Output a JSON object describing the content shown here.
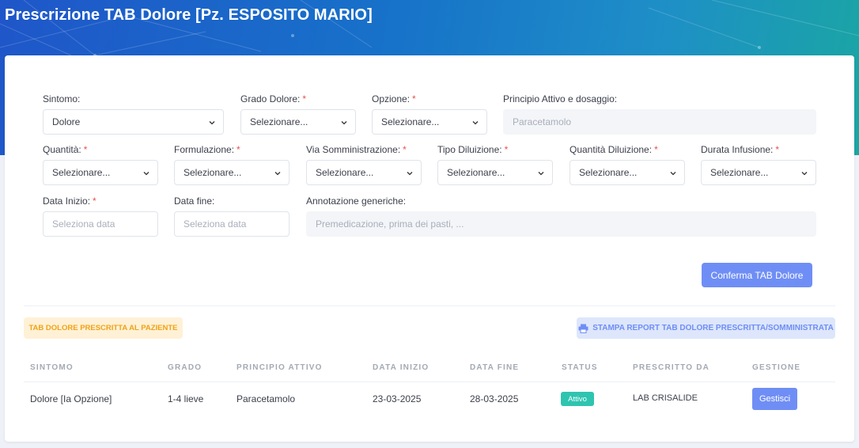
{
  "page": {
    "title": "Prescrizione TAB Dolore [Pz. ESPOSITO MARIO]",
    "colors": {
      "primary": "#6f8ef5",
      "warning": "#f0a215",
      "success": "#2ec4b0",
      "required": "#e5534b"
    }
  },
  "form": {
    "sintomo": {
      "label": "Sintomo:",
      "value": "Dolore"
    },
    "grado": {
      "label": "Grado Dolore:",
      "value": "Selezionare..."
    },
    "opzione": {
      "label": "Opzione:",
      "value": "Selezionare..."
    },
    "principio": {
      "label": "Principio Attivo e dosaggio:",
      "placeholder": "Paracetamolo"
    },
    "quantita": {
      "label": "Quantità:",
      "value": "Selezionare..."
    },
    "formulazione": {
      "label": "Formulazione:",
      "value": "Selezionare..."
    },
    "via": {
      "label": "Via Somministrazione:",
      "value": "Selezionare..."
    },
    "diluizione": {
      "label": "Tipo Diluizione:",
      "value": "Selezionare..."
    },
    "quantita_diluizione": {
      "label": "Quantità Diluizione:",
      "value": "Selezionare..."
    },
    "durata": {
      "label": "Durata Infusione:",
      "value": "Selezionare..."
    },
    "data_inizio": {
      "label": "Data Inizio:",
      "placeholder": "Seleziona data"
    },
    "data_fine": {
      "label": "Data fine:",
      "placeholder": "Seleziona data"
    },
    "annotazione": {
      "label": "Annotazione generiche:",
      "placeholder": "Premedicazione, prima dei pasti, ..."
    },
    "required_mark": "*",
    "confirm_label": "Conferma TAB Dolore"
  },
  "list": {
    "badge": "TAB DOLORE PRESCRITTA AL PAZIENTE",
    "print_label": "STAMPA REPORT TAB DOLORE PRESCRITTA/SOMMINISTRATA",
    "print_icon": "printer-icon",
    "columns": [
      "SINTOMO",
      "GRADO",
      "PRINCIPIO ATTIVO",
      "DATA INIZIO",
      "DATA FINE",
      "STATUS",
      "PRESCRITTO DA",
      "GESTIONE"
    ],
    "rows": [
      {
        "sintomo": "Dolore [Ia Opzione]",
        "grado": "1-4 lieve",
        "principio": "Paracetamolo",
        "data_inizio": "23-03-2025",
        "data_fine": "28-03-2025",
        "status": "Attivo",
        "prescritto_da": "LAB CRISALIDE",
        "action": "Gestisci"
      }
    ]
  }
}
